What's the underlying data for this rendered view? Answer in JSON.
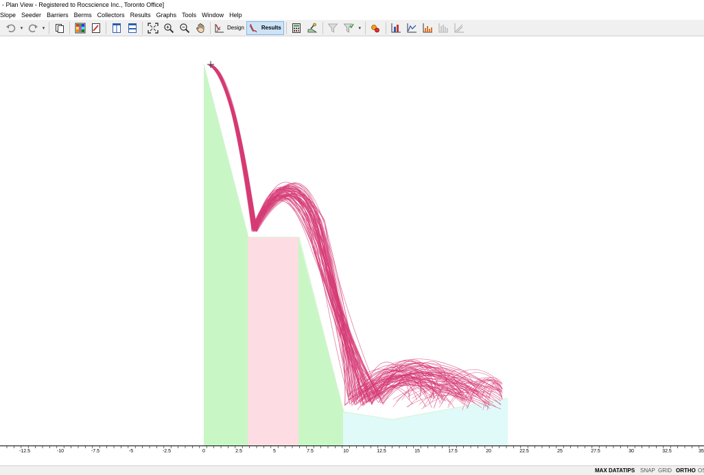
{
  "window": {
    "title": "- Plan View - Registered to Rocscience Inc., Toronto Office]"
  },
  "menu": {
    "items": [
      "Slope",
      "Seeder",
      "Barriers",
      "Berms",
      "Collectors",
      "Results",
      "Graphs",
      "Tools",
      "Window",
      "Help"
    ]
  },
  "toolbar": {
    "design_label": "Design",
    "results_label": "Results",
    "icons": [
      "undo-icon",
      "redo-icon",
      "copy-icon",
      "color-grid-icon",
      "edit-icon",
      "tile-vertical-icon",
      "tile-horizontal-icon",
      "zoom-all-icon",
      "zoom-in-icon",
      "zoom-out-icon",
      "pan-icon",
      "design-mode-icon",
      "results-mode-icon",
      "calculator-icon",
      "seeder-icon",
      "filter-icon",
      "filter-dropdown-icon",
      "highlight-path-icon",
      "histogram-icon",
      "line-graph-icon",
      "bar-graph-icon",
      "collector-graph-icon",
      "angle-graph-icon"
    ]
  },
  "colors": {
    "slope_green": "#c8f7c5",
    "slope_pink": "#fddde3",
    "slope_cyan": "#e0fafa",
    "trajectory": "#d63b76"
  },
  "ruler": {
    "labels": [
      "-12.5",
      "-10",
      "-7.5",
      "-5",
      "-2.5",
      "0",
      "2.5",
      "5",
      "7.5",
      "10",
      "12.5",
      "15",
      "17.5",
      "20",
      "22.5",
      "25",
      "27.5",
      "30",
      "32.5",
      "35"
    ]
  },
  "status": {
    "max_datatips": "MAX DATATIPS",
    "snap": "SNAP",
    "grid": "GRID",
    "ortho": "ORTHO",
    "osnap": "OS"
  }
}
